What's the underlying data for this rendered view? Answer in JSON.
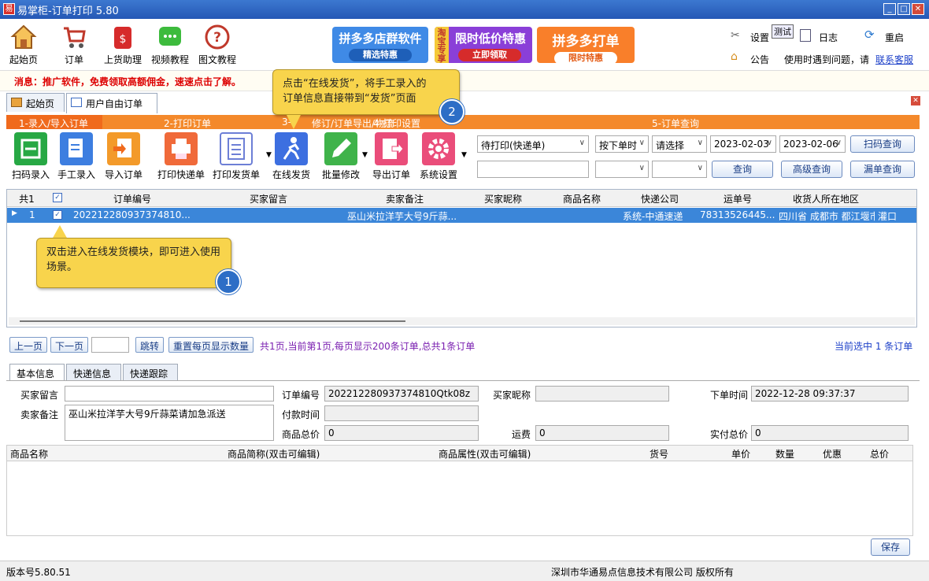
{
  "window": {
    "title": "易掌柜-订单打印 5.80",
    "app_icon": "易",
    "min": "_",
    "max": "□",
    "close": "✕"
  },
  "toolbar_top": {
    "items": [
      {
        "label": "起始页",
        "icon": "home-icon"
      },
      {
        "label": "订单",
        "icon": "cart-icon"
      },
      {
        "label": "上货助理",
        "icon": "moneybag-icon"
      },
      {
        "label": "视频教程",
        "icon": "chat-icon"
      },
      {
        "label": "图文教程",
        "icon": "help-icon"
      }
    ],
    "banners": [
      {
        "title": "拼多多店群软件",
        "sub": "精选特惠",
        "color": "#3f8ae6"
      },
      {
        "side": "淘宝专享",
        "title": "限时低价特惠",
        "sub": "立即领取",
        "color": "#8a3fd8"
      },
      {
        "title": "拼多多打单",
        "sub": "限时特惠",
        "color": "#f97f2a"
      }
    ],
    "right": {
      "settings": "设置",
      "test_badge": "测试",
      "log": "日志",
      "restart": "重启",
      "notice": "公告",
      "help_text": "使用时遇到问题，请",
      "contact": "联系客服"
    }
  },
  "message": "消息：推广软件，免费领取高额佣金，速速点击了解。",
  "tabs_main": [
    {
      "label": "起始页"
    },
    {
      "label": "用户自由订单"
    }
  ],
  "sections": {
    "s1": "1-录入/导入订单",
    "s2": "2-打印订单",
    "s3": "3-(",
    "s3b": "修订/订单导出/物流",
    "s4": "4-打印设置",
    "s5": "5-订单查询"
  },
  "toolbar2": {
    "items": [
      {
        "label": "扫码录入",
        "color": "#27a844"
      },
      {
        "label": "手工录入",
        "color": "#3d7ee0"
      },
      {
        "label": "导入订单",
        "color": "#f39a2a"
      },
      {
        "label": "打印快递单",
        "color": "#f06a3a"
      },
      {
        "label": "打印发货单",
        "color": "#6d7fd6"
      },
      {
        "label": "在线发货",
        "color": "#3d6fe0"
      },
      {
        "label": "批量修改",
        "color": "#3fb34a"
      },
      {
        "label": "导出订单",
        "color": "#ea4d7a"
      },
      {
        "label": "系统设置",
        "color": "#ea4d7a"
      }
    ]
  },
  "query": {
    "print_status": "待打印(快递单)",
    "order_time": "按下单时",
    "choose": "请选择",
    "date_from": "2023-02-03",
    "date_to": "2023-02-06",
    "scan_query": "扫码查询",
    "query": "查询",
    "advanced_query": "高级查询",
    "missing_query": "漏单查询"
  },
  "grid": {
    "headers": [
      "共1",
      "订单编号",
      "买家留言",
      "卖家备注",
      "买家昵称",
      "商品名称",
      "快递公司",
      "运单号",
      "收货人所在地区"
    ],
    "row": {
      "index": "1",
      "order_no": "202212280937374810...",
      "buyer_msg": "",
      "seller_note": "巫山米拉洋芋大号9斤蒜...",
      "buyer_nick": "",
      "product": "",
      "express": "系统-中通速递",
      "waybill": "78313526445...",
      "region": "四川省 成都市 都江堰市",
      "extra": "灌口"
    }
  },
  "callouts": {
    "c1": "双击进入在线发货模块，即可进入使用场景。",
    "c1_num": "1",
    "c2_line1": "点击“在线发货”，将手工录入的",
    "c2_line2": "订单信息直接带到“发货”页面",
    "c2_num": "2"
  },
  "pager": {
    "prev": "上一页",
    "next": "下一页",
    "page_input": "",
    "jump": "跳转",
    "reset": "重置每页显示数量",
    "info": "共1页,当前第1页,每页显示200条订单,总共1条订单",
    "selected": "当前选中 1 条订单"
  },
  "detail_tabs": [
    {
      "label": "基本信息"
    },
    {
      "label": "快递信息"
    },
    {
      "label": "快递跟踪"
    }
  ],
  "detail": {
    "buyer_msg_label": "买家留言",
    "buyer_msg": "",
    "seller_note_label": "卖家备注",
    "seller_note": "巫山米拉洋芋大号9斤蒜菜请加急派送",
    "order_no_label": "订单编号",
    "order_no": "202212280937374810Qtk08z",
    "buyer_nick_label": "买家昵称",
    "buyer_nick": "",
    "order_time_label": "下单时间",
    "order_time": "2022-12-28 09:37:37",
    "pay_time_label": "付款时间",
    "pay_time": "",
    "goods_total_label": "商品总价",
    "goods_total": "0",
    "freight_label": "运费",
    "freight": "0",
    "actual_total_label": "实付总价",
    "actual_total": "0"
  },
  "goods_headers": [
    "商品名称",
    "商品简称(双击可编辑)",
    "商品属性(双击可编辑)",
    "货号",
    "单价",
    "数量",
    "优惠",
    "总价"
  ],
  "save": "保存",
  "status": {
    "version": "版本号5.80.51",
    "copyright": "深圳市华通易点信息技术有限公司 版权所有"
  }
}
